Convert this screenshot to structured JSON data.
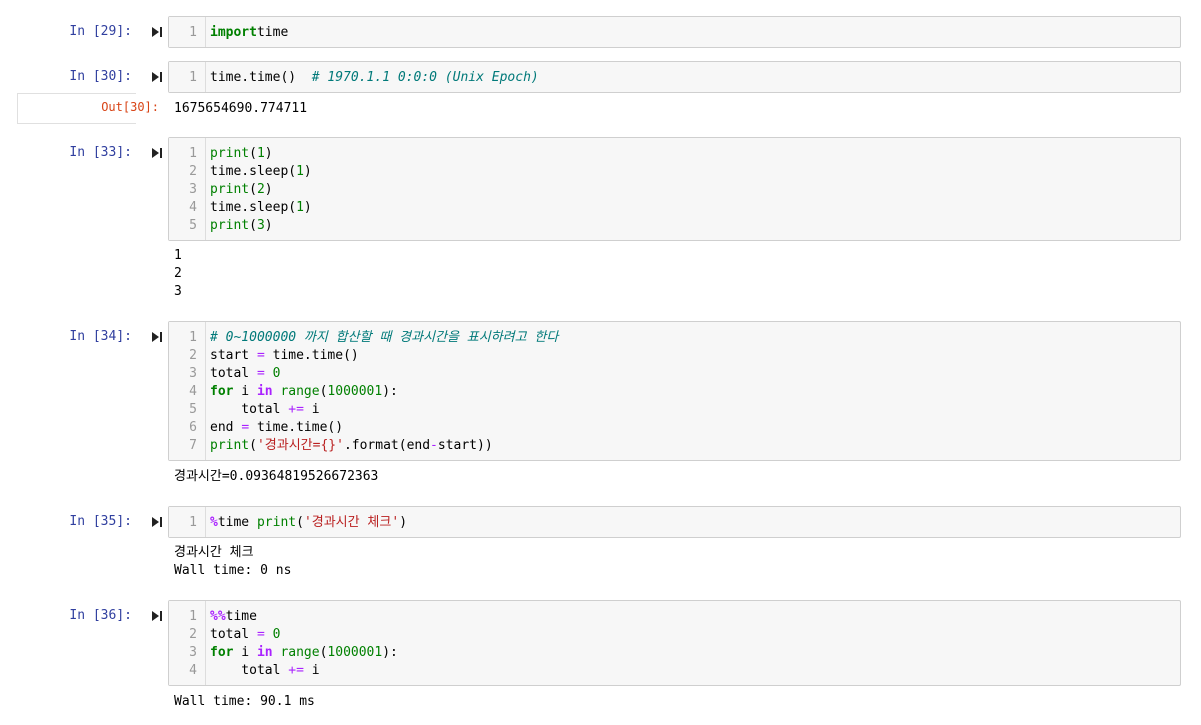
{
  "cells": [
    {
      "prompt": "In [29]:",
      "lines": [
        {
          "num": "1",
          "tokens": [
            [
              "kw",
              "import"
            ],
            [
              "",
              "time"
            ]
          ]
        }
      ]
    },
    {
      "prompt": "In [30]:",
      "lines": [
        {
          "num": "1",
          "tokens": [
            [
              "",
              "time.time()  "
            ],
            [
              "cm",
              "# 1970.1.1 0:0:0 (Unix Epoch)"
            ]
          ]
        }
      ],
      "out_prompt": "Out[30]:",
      "output": [
        "1675654690.774711"
      ]
    },
    {
      "prompt": "In [33]:",
      "lines": [
        {
          "num": "1",
          "tokens": [
            [
              "bi",
              "print"
            ],
            [
              "",
              "("
            ],
            [
              "num",
              "1"
            ],
            [
              "",
              ")"
            ]
          ]
        },
        {
          "num": "2",
          "tokens": [
            [
              "",
              "time.sleep("
            ],
            [
              "num",
              "1"
            ],
            [
              "",
              ")"
            ]
          ]
        },
        {
          "num": "3",
          "tokens": [
            [
              "bi",
              "print"
            ],
            [
              "",
              "("
            ],
            [
              "num",
              "2"
            ],
            [
              "",
              ")"
            ]
          ]
        },
        {
          "num": "4",
          "tokens": [
            [
              "",
              "time.sleep("
            ],
            [
              "num",
              "1"
            ],
            [
              "",
              ")"
            ]
          ]
        },
        {
          "num": "5",
          "tokens": [
            [
              "bi",
              "print"
            ],
            [
              "",
              "("
            ],
            [
              "num",
              "3"
            ],
            [
              "",
              ")"
            ]
          ]
        }
      ],
      "output": [
        "1",
        "2",
        "3"
      ]
    },
    {
      "prompt": "In [34]:",
      "lines": [
        {
          "num": "1",
          "tokens": [
            [
              "cm",
              "# 0~1000000 까지 합산할 때 경과시간을 표시하려고 한다"
            ]
          ]
        },
        {
          "num": "2",
          "tokens": [
            [
              "",
              "start "
            ],
            [
              "op",
              "="
            ],
            [
              "",
              " time.time()"
            ]
          ]
        },
        {
          "num": "3",
          "tokens": [
            [
              "",
              "total "
            ],
            [
              "op",
              "="
            ],
            [
              "",
              " "
            ],
            [
              "num",
              "0"
            ]
          ]
        },
        {
          "num": "4",
          "tokens": [
            [
              "kw",
              "for"
            ],
            [
              "",
              " i "
            ],
            [
              "opb",
              "in"
            ],
            [
              "",
              " "
            ],
            [
              "bi",
              "range"
            ],
            [
              "",
              "("
            ],
            [
              "num",
              "1000001"
            ],
            [
              "",
              "):"
            ]
          ]
        },
        {
          "num": "5",
          "tokens": [
            [
              "",
              "    total "
            ],
            [
              "op",
              "+="
            ],
            [
              "",
              " i"
            ]
          ]
        },
        {
          "num": "6",
          "tokens": [
            [
              "",
              "end "
            ],
            [
              "op",
              "="
            ],
            [
              "",
              " time.time()"
            ]
          ]
        },
        {
          "num": "7",
          "tokens": [
            [
              "bi",
              "print"
            ],
            [
              "",
              "("
            ],
            [
              "str",
              "'경과시간={}'"
            ],
            [
              "",
              ".format(end"
            ],
            [
              "op",
              "-"
            ],
            [
              "",
              "start))"
            ]
          ]
        }
      ],
      "output": [
        "경과시간=0.09364819526672363"
      ]
    },
    {
      "prompt": "In [35]:",
      "lines": [
        {
          "num": "1",
          "tokens": [
            [
              "opb",
              "%"
            ],
            [
              "",
              "time "
            ],
            [
              "bi",
              "print"
            ],
            [
              "",
              "("
            ],
            [
              "str",
              "'경과시간 체크'"
            ],
            [
              "",
              ")"
            ]
          ]
        }
      ],
      "output": [
        "경과시간 체크",
        "Wall time: 0 ns"
      ]
    },
    {
      "prompt": "In [36]:",
      "lines": [
        {
          "num": "1",
          "tokens": [
            [
              "opb",
              "%%"
            ],
            [
              "",
              "time"
            ]
          ]
        },
        {
          "num": "2",
          "tokens": [
            [
              "",
              "total "
            ],
            [
              "op",
              "="
            ],
            [
              "",
              " "
            ],
            [
              "num",
              "0"
            ]
          ]
        },
        {
          "num": "3",
          "tokens": [
            [
              "kw",
              "for"
            ],
            [
              "",
              " i "
            ],
            [
              "opb",
              "in"
            ],
            [
              "",
              " "
            ],
            [
              "bi",
              "range"
            ],
            [
              "",
              "("
            ],
            [
              "num",
              "1000001"
            ],
            [
              "",
              "):"
            ]
          ]
        },
        {
          "num": "4",
          "tokens": [
            [
              "",
              "    total "
            ],
            [
              "op",
              "+="
            ],
            [
              "",
              " i"
            ]
          ]
        }
      ],
      "output": [
        "Wall time: 90.1 ms"
      ]
    }
  ],
  "colors": {
    "prompt_in": "#303f9f",
    "prompt_out": "#d84315",
    "keyword": "#008000",
    "operator": "#aa22ff",
    "string": "#ba2121",
    "comment": "#007979"
  },
  "icons": {
    "run": "step-forward-icon"
  }
}
